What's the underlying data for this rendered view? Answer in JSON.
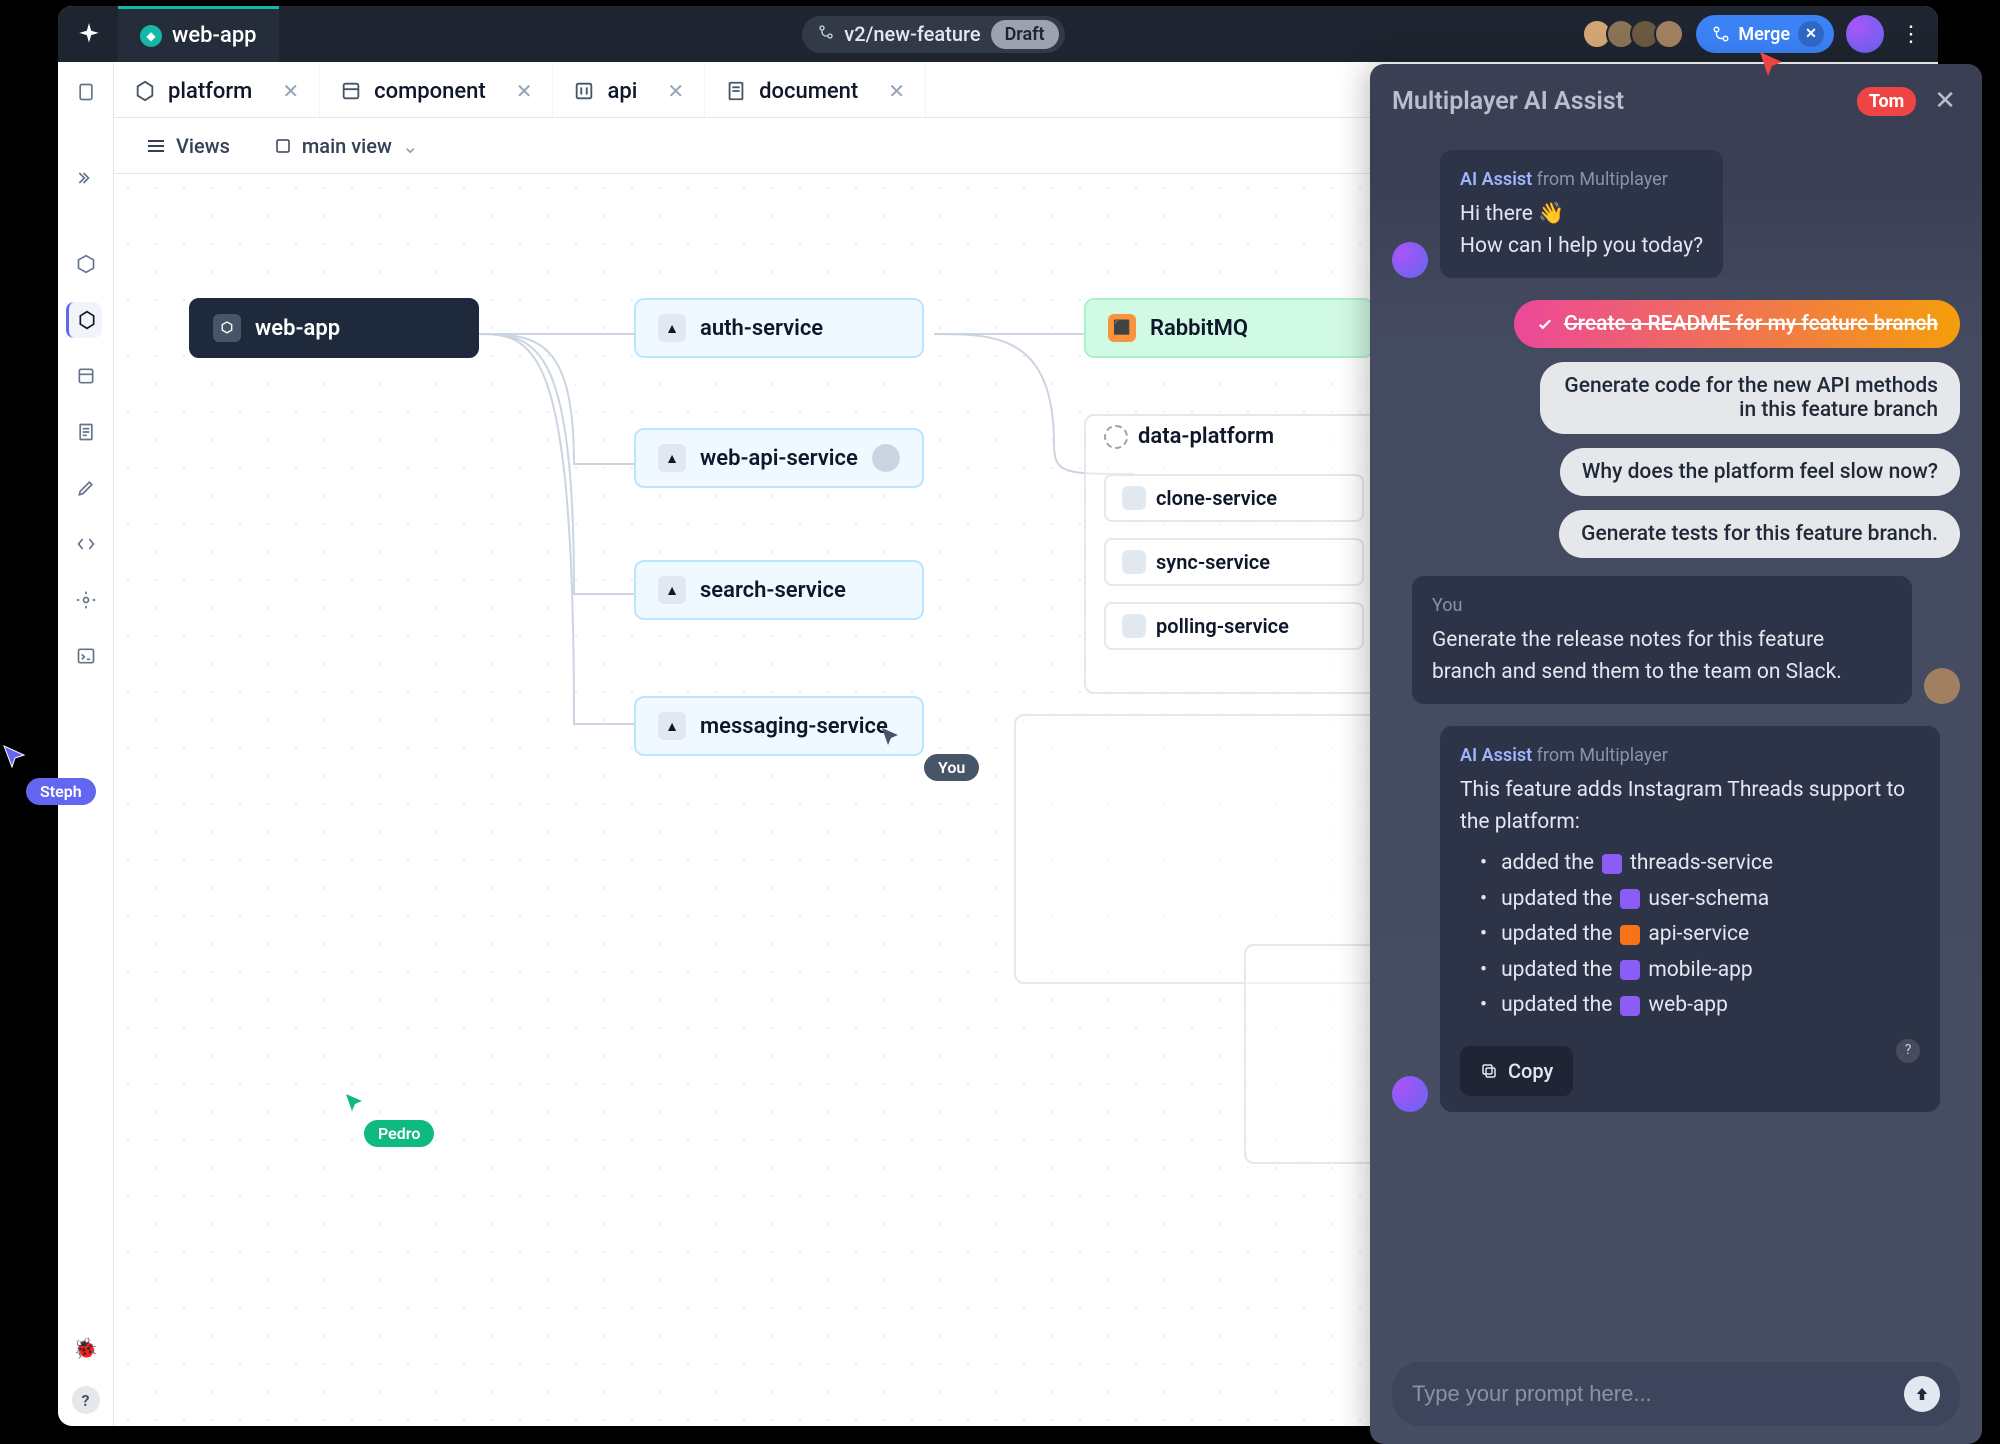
{
  "top": {
    "app_name": "web-app",
    "branch_name": "v2/new-feature",
    "draft_label": "Draft",
    "merge_label": "Merge"
  },
  "tabs": [
    {
      "label": "platform",
      "type": "hex"
    },
    {
      "label": "component",
      "type": "component"
    },
    {
      "label": "api",
      "type": "api"
    },
    {
      "label": "document",
      "type": "doc"
    }
  ],
  "toolbar": {
    "views_label": "Views",
    "main_view_label": "main view"
  },
  "nodes": {
    "webapp": "web-app",
    "auth": "auth-service",
    "webapi": "web-api-service",
    "search": "search-service",
    "messaging": "messaging-service",
    "rabbit": "RabbitMQ",
    "data_platform": "data-platform",
    "clone": "clone-service",
    "sync": "sync-service",
    "polling": "polling-service"
  },
  "cursors": {
    "steph": "Steph",
    "pedro": "Pedro",
    "you": "You"
  },
  "ai": {
    "panel_title": "Multiplayer AI Assist",
    "tom_badge": "Tom",
    "assist_name": "AI Assist",
    "assist_from": "from Multiplayer",
    "greeting_1": "Hi there 👋",
    "greeting_2": "How can I help you today?",
    "suggest_1": "Create a README for my feature branch",
    "suggest_2": "Generate code for the new API methods in this feature branch",
    "suggest_3": "Why does the platform feel slow now?",
    "suggest_4": "Generate tests for this feature branch.",
    "you_label": "You",
    "you_msg": "Generate the release notes for this feature branch and send them to the team on Slack.",
    "release_intro": "This feature adds Instagram Threads support to the platform:",
    "bullets": {
      "b1_pre": "added the",
      "b1_link": "threads-service",
      "b2_pre": "updated the",
      "b2_link": "user-schema",
      "b3_pre": "updated the",
      "b3_link": "api-service",
      "b4_pre": "updated the",
      "b4_link": "mobile-app",
      "b5_pre": "updated the",
      "b5_link": "web-app"
    },
    "copy_label": "Copy",
    "prompt_placeholder": "Type your prompt here..."
  }
}
